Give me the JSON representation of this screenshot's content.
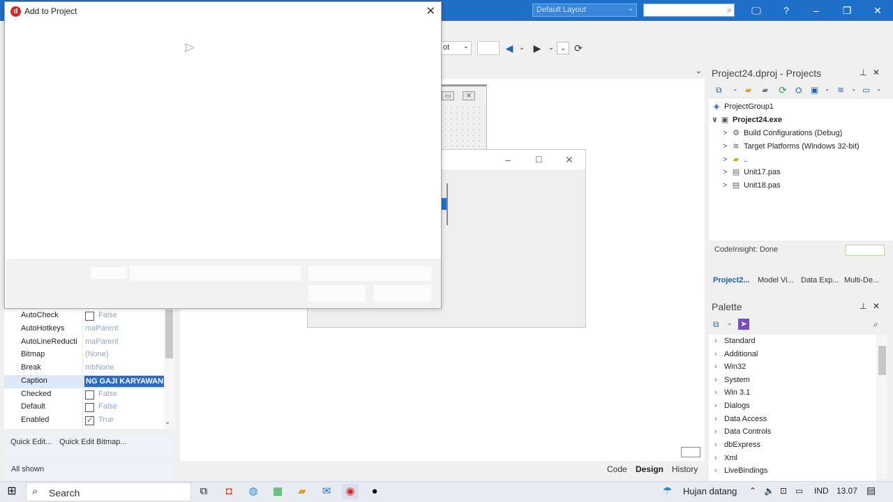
{
  "titlebar": {
    "layout_label": "Default Layout",
    "search_value": "",
    "help_label": "?",
    "minimize_label": "–",
    "restore_label": "❐",
    "close_label": "✕",
    "accent_color": "#1e6fc8"
  },
  "toolbar": {
    "platform_combo_value": "ot",
    "back_icon": "arrow-left-icon",
    "forward_icon": "arrow-right-icon"
  },
  "designer": {
    "tabs": [
      {
        "label": "Code"
      },
      {
        "label": "Design"
      },
      {
        "label": "History"
      }
    ],
    "active_tab": "Design"
  },
  "dialog": {
    "title": "Add to Project",
    "close_label": "✕"
  },
  "inspector": {
    "properties": [
      {
        "name": "AutoCheck",
        "value": "False",
        "type": "checkbox",
        "checked": false
      },
      {
        "name": "AutoHotkeys",
        "value": "maParent",
        "type": "text"
      },
      {
        "name": "AutoLineReducti",
        "value": "maParent",
        "type": "text"
      },
      {
        "name": "Bitmap",
        "value": "(None)",
        "type": "text"
      },
      {
        "name": "Break",
        "value": "mbNone",
        "type": "text"
      },
      {
        "name": "Caption",
        "value": "NG GAJI KARYAWAN",
        "type": "edit",
        "selected": true
      },
      {
        "name": "Checked",
        "value": "False",
        "type": "checkbox",
        "checked": false
      },
      {
        "name": "Default",
        "value": "False",
        "type": "checkbox",
        "checked": false
      },
      {
        "name": "Enabled",
        "value": "True",
        "type": "checkbox",
        "checked": true
      }
    ],
    "quick_edit_label": "Quick Edit...",
    "quick_edit_bitmap_label": "Quick Edit Bitmap...",
    "filter_status": "All shown"
  },
  "projects": {
    "title": "Project24.dproj - Projects",
    "tree": [
      {
        "label": "ProjectGroup1",
        "level": 0,
        "expander": "",
        "icon": "project-group-icon",
        "bold": false
      },
      {
        "label": "Project24.exe",
        "level": 0,
        "expander": "∨",
        "icon": "exe-icon",
        "bold": true
      },
      {
        "label": "Build Configurations (Debug)",
        "level": 1,
        "expander": ">",
        "icon": "gear-icon",
        "bold": false
      },
      {
        "label": "Target Platforms (Windows 32-bit)",
        "level": 1,
        "expander": ">",
        "icon": "platforms-icon",
        "bold": false
      },
      {
        "label": "..",
        "level": 1,
        "expander": ">",
        "icon": "folder-icon",
        "bold": false
      },
      {
        "label": "Unit17.pas",
        "level": 1,
        "expander": ">",
        "icon": "unit-file-icon",
        "bold": false
      },
      {
        "label": "Unit18.pas",
        "level": 1,
        "expander": ">",
        "icon": "unit-file-icon",
        "bold": false
      }
    ],
    "codeinsight_status": "CodeInsight: Done",
    "tabs": [
      {
        "label": "Project2..."
      },
      {
        "label": "Model Vi..."
      },
      {
        "label": "Data Exp..."
      },
      {
        "label": "Multi-De..."
      }
    ],
    "active_tab": "Project2..."
  },
  "palette": {
    "title": "Palette",
    "search_value": "",
    "items": [
      {
        "label": "Standard"
      },
      {
        "label": "Additional"
      },
      {
        "label": "Win32"
      },
      {
        "label": "System"
      },
      {
        "label": "Win 3.1"
      },
      {
        "label": "Dialogs"
      },
      {
        "label": "Data Access"
      },
      {
        "label": "Data Controls"
      },
      {
        "label": "dbExpress"
      },
      {
        "label": "Xml"
      },
      {
        "label": "LiveBindings"
      }
    ]
  },
  "taskbar": {
    "search_placeholder": "Search",
    "weather": "Hujan datang",
    "language": "IND",
    "time": "13.07"
  }
}
